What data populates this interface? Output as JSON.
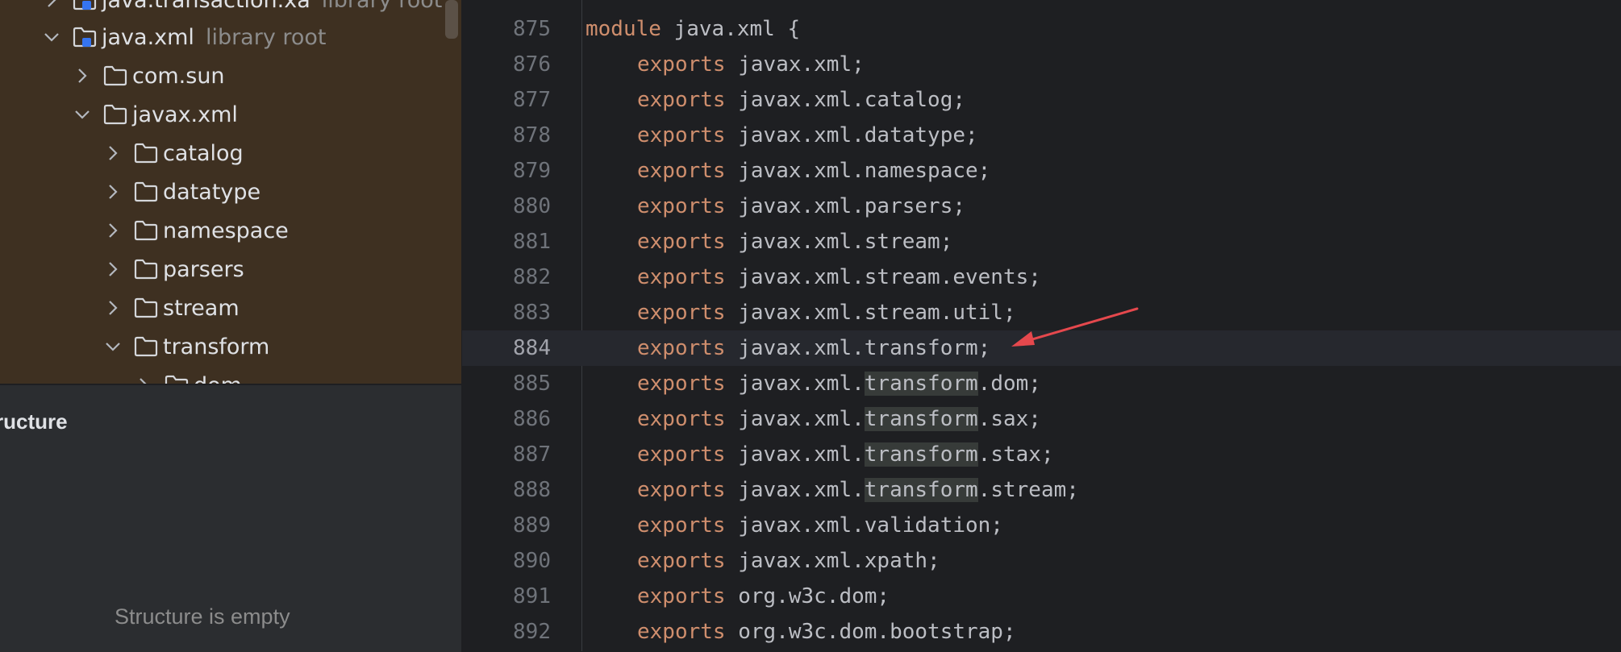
{
  "project_tree": {
    "items": [
      {
        "label": "java.transaction.xa",
        "hint": "library root",
        "type": "module",
        "expanded": false
      },
      {
        "label": "java.xml",
        "hint": "library root",
        "type": "module",
        "expanded": true
      },
      {
        "label": "com.sun",
        "type": "folder",
        "expanded": false
      },
      {
        "label": "javax.xml",
        "type": "folder",
        "expanded": true
      },
      {
        "label": "catalog",
        "type": "folder",
        "expanded": false
      },
      {
        "label": "datatype",
        "type": "folder",
        "expanded": false
      },
      {
        "label": "namespace",
        "type": "folder",
        "expanded": false
      },
      {
        "label": "parsers",
        "type": "folder",
        "expanded": false
      },
      {
        "label": "stream",
        "type": "folder",
        "expanded": false
      },
      {
        "label": "transform",
        "type": "folder",
        "expanded": true
      },
      {
        "label": "dom",
        "type": "folder",
        "expanded": false
      }
    ]
  },
  "structure": {
    "title": "ructure",
    "empty_text": "Structure is empty"
  },
  "editor": {
    "current_line": "884",
    "highlight_word": "transform",
    "header_text": "module java.xml {",
    "keyword": "exports",
    "lines": [
      {
        "no": "875",
        "pkg": "",
        "is_module": true
      },
      {
        "no": "876",
        "pkg": "javax.xml;"
      },
      {
        "no": "877",
        "pkg": "javax.xml.catalog;"
      },
      {
        "no": "878",
        "pkg": "javax.xml.datatype;"
      },
      {
        "no": "879",
        "pkg": "javax.xml.namespace;"
      },
      {
        "no": "880",
        "pkg": "javax.xml.parsers;"
      },
      {
        "no": "881",
        "pkg": "javax.xml.stream;"
      },
      {
        "no": "882",
        "pkg": "javax.xml.stream.events;"
      },
      {
        "no": "883",
        "pkg": "javax.xml.stream.util;"
      },
      {
        "no": "884",
        "pkg": "javax.xml.transform;"
      },
      {
        "no": "885",
        "pkg": "javax.xml.transform.dom;"
      },
      {
        "no": "886",
        "pkg": "javax.xml.transform.sax;"
      },
      {
        "no": "887",
        "pkg": "javax.xml.transform.stax;"
      },
      {
        "no": "888",
        "pkg": "javax.xml.transform.stream;"
      },
      {
        "no": "889",
        "pkg": "javax.xml.validation;"
      },
      {
        "no": "890",
        "pkg": "javax.xml.xpath;"
      },
      {
        "no": "891",
        "pkg": "org.w3c.dom;"
      },
      {
        "no": "892",
        "pkg": "org.w3c.dom.bootstrap;"
      }
    ]
  },
  "annotation": {
    "type": "arrow",
    "color": "#e5484d"
  },
  "colors": {
    "keyword": "#cf8e6d",
    "text": "#bcbec4",
    "line_no": "#6f737a",
    "tree_bg": "#3e3021"
  }
}
